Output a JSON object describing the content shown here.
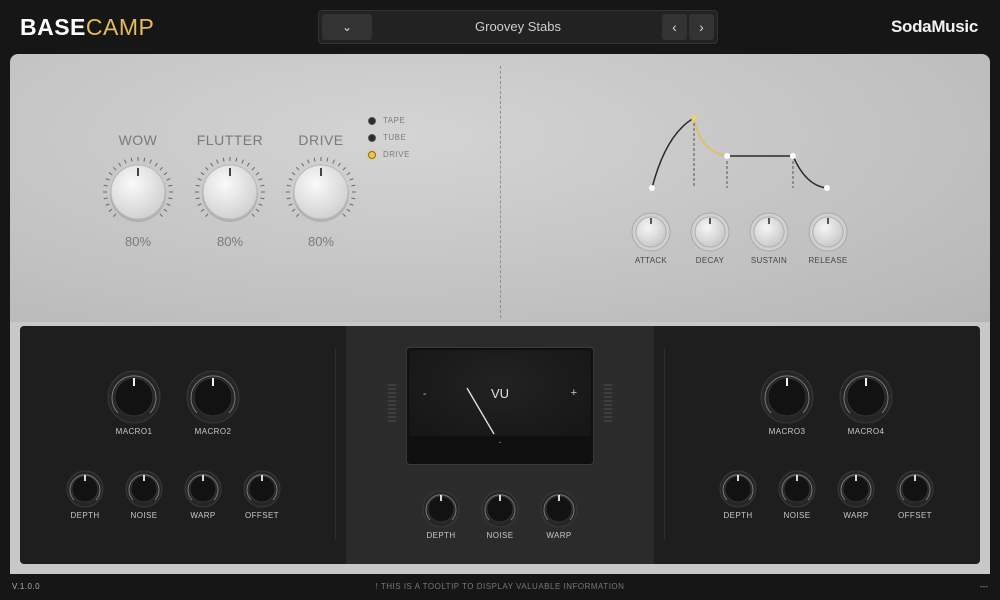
{
  "header": {
    "logo_bold": "BASE",
    "logo_light": "CAMP",
    "preset_dropdown_glyph": "⌄",
    "preset_name": "Groovey Stabs",
    "prev_glyph": "‹",
    "next_glyph": "›",
    "brand": "SodaMusic"
  },
  "tape": {
    "knobs": [
      {
        "label": "WOW",
        "value_text": "80%",
        "value": 0.8
      },
      {
        "label": "FLUTTER",
        "value_text": "80%",
        "value": 0.8
      },
      {
        "label": "DRIVE",
        "value_text": "80%",
        "value": 0.8
      }
    ],
    "modes": [
      {
        "label": "TAPE",
        "active": false
      },
      {
        "label": "TUBE",
        "active": false
      },
      {
        "label": "DRIVE",
        "active": true
      }
    ]
  },
  "envelope": {
    "knobs": [
      {
        "label": "ATTACK"
      },
      {
        "label": "DECAY"
      },
      {
        "label": "SUSTAIN"
      },
      {
        "label": "RELEASE"
      }
    ],
    "accent_color": "#e5bd52"
  },
  "left_panel": {
    "macros": [
      {
        "label": "MACRO1"
      },
      {
        "label": "MACRO2"
      }
    ],
    "small": [
      {
        "label": "DEPTH"
      },
      {
        "label": "NOISE"
      },
      {
        "label": "WARP"
      },
      {
        "label": "OFFSET"
      }
    ]
  },
  "center_panel": {
    "vu_title": "VU",
    "vu_minus": "-",
    "vu_plus": "+",
    "vu_center_mark": "-",
    "small": [
      {
        "label": "DEPTH"
      },
      {
        "label": "NOISE"
      },
      {
        "label": "WARP"
      }
    ]
  },
  "right_panel": {
    "macros": [
      {
        "label": "MACRO3"
      },
      {
        "label": "MACRO4"
      }
    ],
    "small": [
      {
        "label": "DEPTH"
      },
      {
        "label": "NOISE"
      },
      {
        "label": "WARP"
      },
      {
        "label": "OFFSET"
      }
    ]
  },
  "footer": {
    "version": "V.1.0.0",
    "tooltip": "! THIS IS A TOOLTIP TO DISPLAY VALUABLE INFORMATION",
    "right_text": "---"
  },
  "colors": {
    "accent": "#e5bd52",
    "background": "#161616",
    "panel_silver": "#c4c4c4",
    "panel_dark": "#1e1e1e"
  }
}
